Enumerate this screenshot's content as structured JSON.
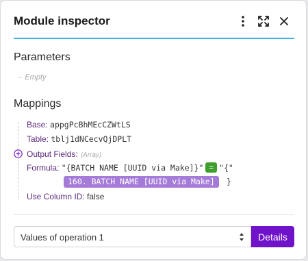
{
  "header": {
    "title": "Module inspector",
    "icons": [
      "more-vertical-icon",
      "expand-icon",
      "close-icon"
    ]
  },
  "parameters": {
    "title": "Parameters",
    "empty_dash": "--",
    "empty_text": "Empty"
  },
  "mappings": {
    "title": "Mappings",
    "base": {
      "key": "Base:",
      "value": "appgPcBhMEcCZWtLS"
    },
    "table": {
      "key": "Table:",
      "value": "tblj1dNCecvQjDPLT"
    },
    "output_fields": {
      "key": "Output Fields:",
      "hint": "(Array)"
    },
    "formula": {
      "key": "Formula:",
      "text_before": "\"{BATCH NAME [UUID via Make]}\"",
      "operator": "=",
      "text_after": "\"{\"",
      "variable": "160. BATCH NAME [UUID via Make]",
      "closing": "}"
    },
    "use_column_id": {
      "key": "Use Column ID:",
      "value": "false"
    }
  },
  "footer": {
    "select_value": "Values of operation 1",
    "details_label": "Details"
  },
  "colors": {
    "accent_line": "#3cb4ea",
    "key_text": "#5a2a7a",
    "operator_green": "#3e9f2c",
    "variable_purple": "#a57bd8",
    "details_button": "#6f12c9"
  }
}
